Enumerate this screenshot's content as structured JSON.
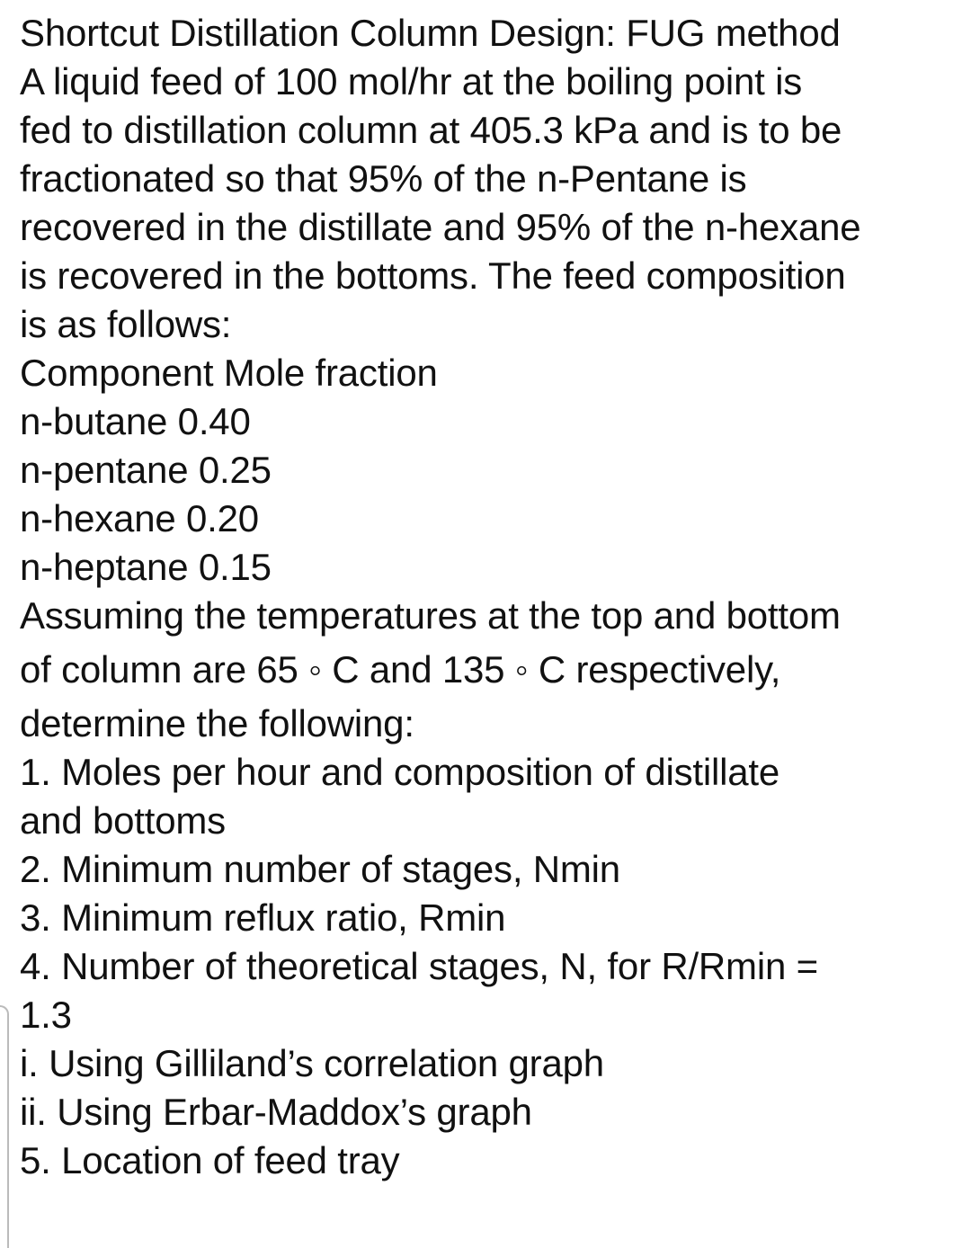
{
  "document": {
    "title": "Shortcut Distillation Column Design: FUG method",
    "intro_lines": [
      "A liquid feed of 100 mol/hr at the boiling point is",
      "fed to distillation column at 405.3 kPa and is to be",
      "fractionated so that 95% of the n-Pentane is",
      "recovered in the distillate and 95% of the n-hexane",
      "is recovered in the bottoms. The feed composition",
      "is as follows:"
    ],
    "table_header": "Component Mole fraction",
    "components": [
      {
        "name": "n-butane",
        "mole_fraction": "0.40",
        "text": "n-butane 0.40"
      },
      {
        "name": "n-pentane",
        "mole_fraction": "0.25",
        "text": "n-pentane 0.25"
      },
      {
        "name": "n-hexane",
        "mole_fraction": "0.20",
        "text": "n-hexane 0.20"
      },
      {
        "name": "n-heptane",
        "mole_fraction": "0.15",
        "text": "n-heptane 0.15"
      }
    ],
    "assumption_lines": [
      "Assuming the temperatures at the top and bottom",
      "of column are 65 ◦ C and 135 ◦ C respectively,",
      "determine the following:"
    ],
    "tasks": [
      "1. Moles per hour and composition of distillate",
      "and bottoms",
      "2. Minimum number of stages, Nmin",
      "3. Minimum reflux ratio, Rmin",
      "4. Number of theoretical stages, N, for R/Rmin =",
      "1.3",
      "i. Using Gilliland’s correlation graph",
      "ii. Using Erbar-Maddox’s graph",
      "5. Location of feed tray"
    ]
  }
}
